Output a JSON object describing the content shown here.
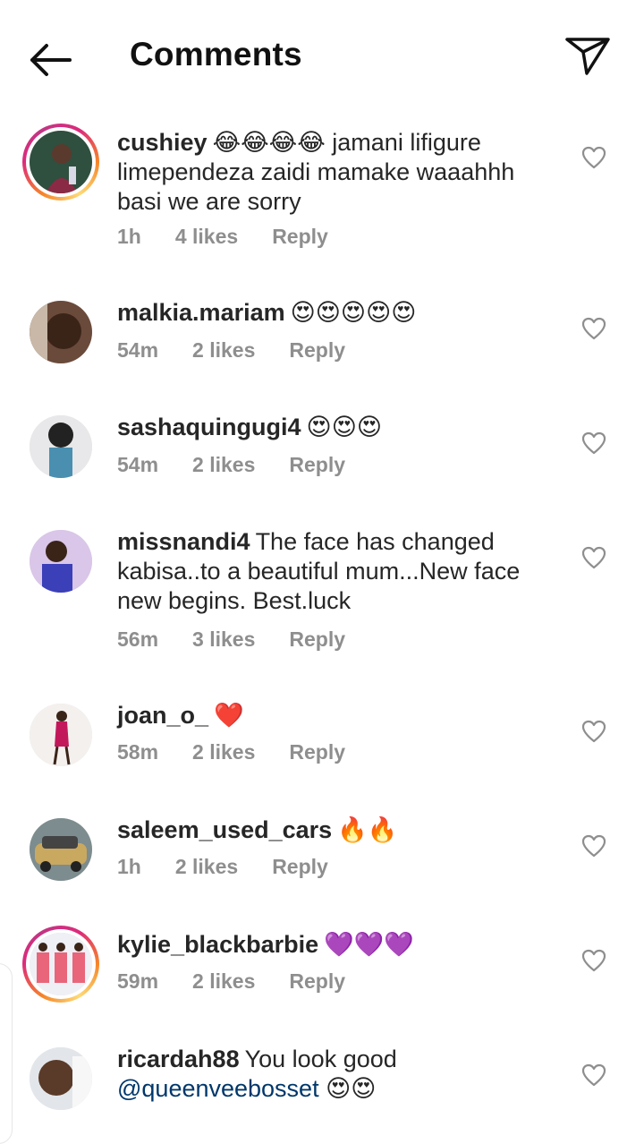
{
  "header": {
    "title": "Comments",
    "back_icon": "arrow-left-icon",
    "share_icon": "paper-plane-icon"
  },
  "comments": [
    {
      "username": "cushiey",
      "emoji": "😂😂😂😂",
      "text": "jamani lifigure limependeza zaidi mamake waaahhh basi we are sorry",
      "time": "1h",
      "likes": "4 likes",
      "reply": "Reply",
      "story_ring": true
    },
    {
      "username": "malkia.mariam",
      "emoji": "😍😍😍😍😍",
      "text": "",
      "time": "54m",
      "likes": "2 likes",
      "reply": "Reply",
      "story_ring": false
    },
    {
      "username": "sashaquingugi4",
      "emoji": "😍😍😍",
      "text": "",
      "time": "54m",
      "likes": "2 likes",
      "reply": "Reply",
      "story_ring": false
    },
    {
      "username": "missnandi4",
      "emoji": "",
      "text": "The face has changed kabisa..to a beautiful mum...New face new begins. Best.luck",
      "time": "56m",
      "likes": "3 likes",
      "reply": "Reply",
      "story_ring": false
    },
    {
      "username": "joan_o_",
      "emoji": "❤️",
      "text": "",
      "time": "58m",
      "likes": "2 likes",
      "reply": "Reply",
      "story_ring": false
    },
    {
      "username": "saleem_used_cars",
      "emoji": "🔥🔥",
      "text": "",
      "time": "1h",
      "likes": "2 likes",
      "reply": "Reply",
      "story_ring": false
    },
    {
      "username": "kylie_blackbarbie",
      "emoji": "💜💜💜",
      "text": "",
      "time": "59m",
      "likes": "2 likes",
      "reply": "Reply",
      "story_ring": true
    },
    {
      "username": "ricardah88",
      "emoji": "😍😍",
      "text": "You look good",
      "mention": "@queenveebosset",
      "time": "",
      "likes": "",
      "reply": "",
      "story_ring": false
    }
  ],
  "colors": {
    "text": "#262626",
    "meta": "#8e8e8e",
    "mention": "#00376b",
    "ring_start": "#f58529",
    "ring_mid": "#dd2a7b"
  }
}
